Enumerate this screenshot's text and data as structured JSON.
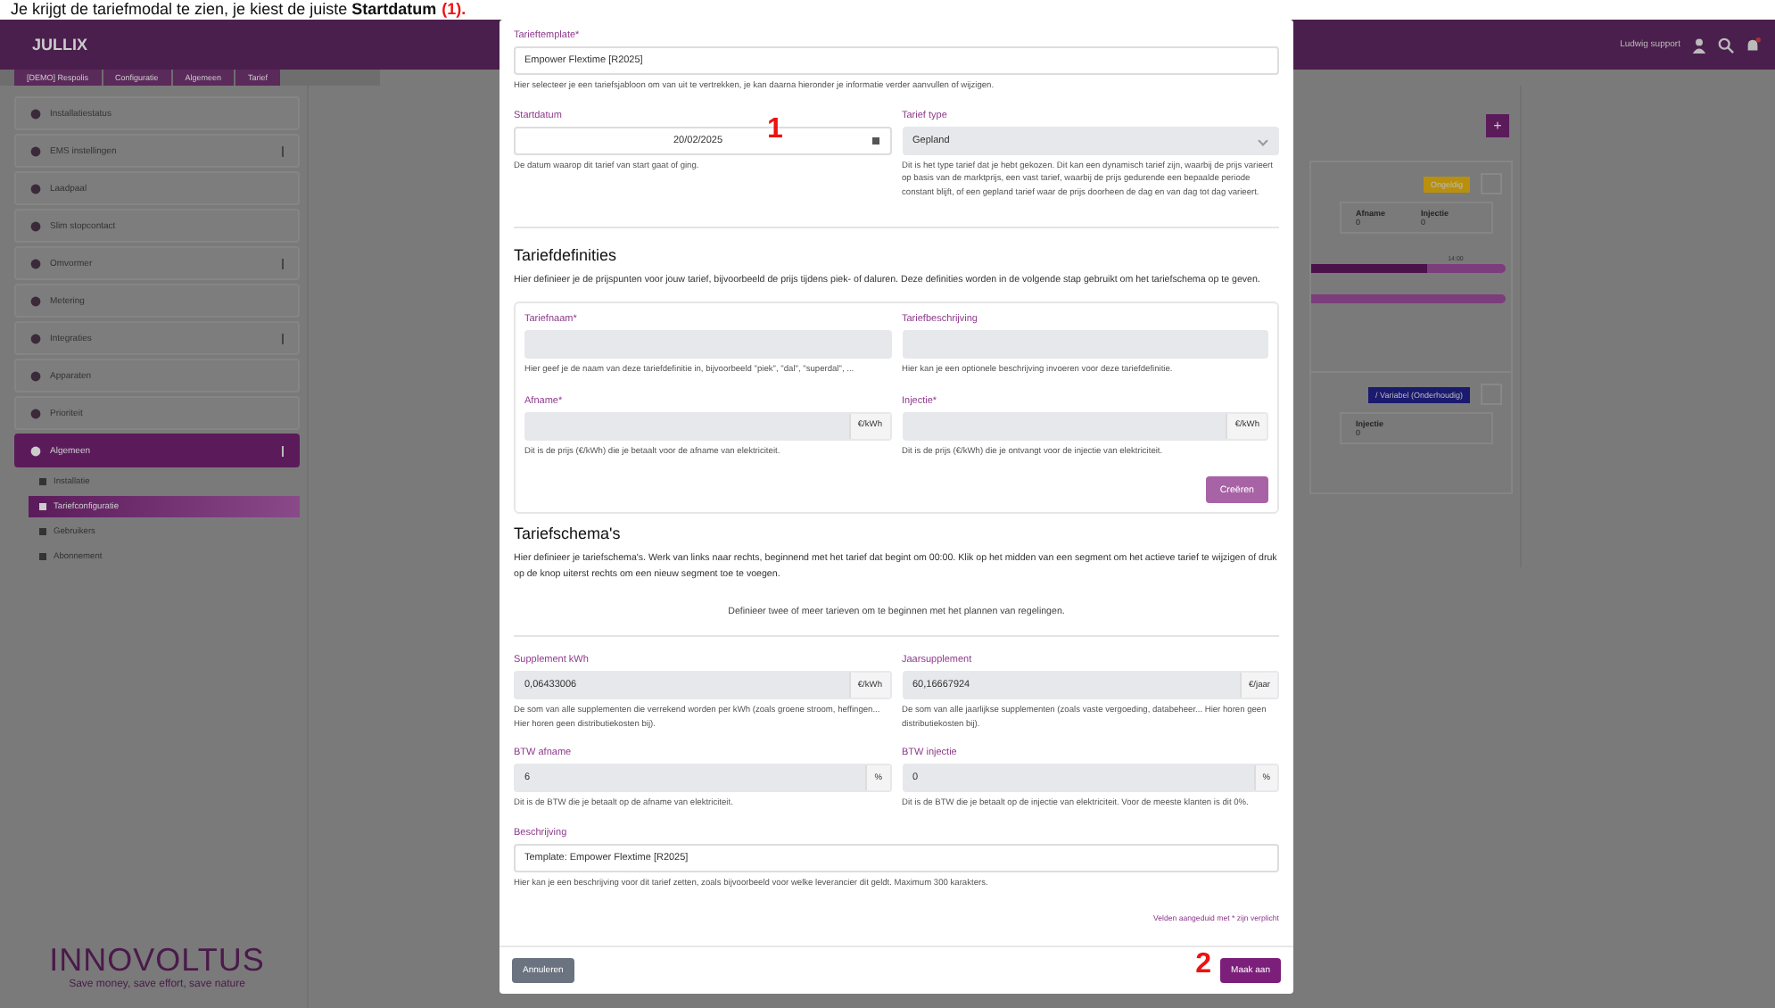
{
  "caption": {
    "text": "Je krijgt de tariefmodal te zien, je kiest de juiste **Startdatum**",
    "marker": "(1)."
  },
  "header": {
    "logo": "JULLIX",
    "user": "Ludwig support"
  },
  "breadcrumb": [
    {
      "label": "[DEMO] Respolis"
    },
    {
      "label": "Configuratie"
    },
    {
      "label": "Algemeen"
    },
    {
      "label": "Tarief"
    }
  ],
  "sidebar": {
    "items": [
      {
        "label": "Installatiestatus",
        "menu": false,
        "selected": false
      },
      {
        "label": "EMS instellingen",
        "menu": true,
        "selected": false
      },
      {
        "label": "Laadpaal",
        "menu": false,
        "selected": false
      },
      {
        "label": "Slim stopcontact",
        "menu": false,
        "selected": false
      },
      {
        "label": "Omvormer",
        "menu": true,
        "selected": false
      },
      {
        "label": "Metering",
        "menu": false,
        "selected": false
      },
      {
        "label": "Integraties",
        "menu": true,
        "selected": false
      },
      {
        "label": "Apparaten",
        "menu": false,
        "selected": false
      },
      {
        "label": "Prioriteit",
        "menu": false,
        "selected": false
      },
      {
        "label": "Algemeen",
        "menu": true,
        "selected": true,
        "children": [
          {
            "label": "Installatie",
            "selected": false
          },
          {
            "label": "Tariefconfiguratie",
            "selected": true
          },
          {
            "label": "Gebruikers",
            "selected": false
          },
          {
            "label": "Abonnement",
            "selected": false
          }
        ]
      }
    ],
    "brand": "INNOVOLTUS",
    "slogan": "Save money, save effort, save nature"
  },
  "background": {
    "add_button": "+",
    "cards": [
      {
        "badge": "Ongeldig",
        "color": "#b8900e",
        "stats": [
          {
            "label": "Afname",
            "value": "0"
          },
          {
            "label": "Injectie",
            "value": "0"
          }
        ],
        "bar_label": "14:00",
        "bars": [
          {
            "level": 0.6
          }
        ],
        "schedule_bar": true
      },
      {
        "badge": "/ Variabel (Onderhoudig)",
        "color": "#1a1a6e",
        "stats": [
          {
            "label": "Injectie",
            "value": "0"
          }
        ]
      }
    ]
  },
  "modal": {
    "general": [
      [
        {
          "label": "Tarieftemplate*",
          "value": "Empower Flextime [R2025]",
          "kind": "input",
          "hint": "Hier selecteer je een tariefsjabloon om van uit te vertrekken, je kan daarna hieronder je informatie verder aanvullen of wijzigen."
        }
      ],
      [
        {
          "label": "Startdatum",
          "value": "20/02/2025",
          "kind": "date",
          "hint": "De datum waarop dit tarief van start gaat of ging."
        },
        {
          "label": "Tarief type",
          "value": "Gepland",
          "kind": "select",
          "hint": "Dit is het type tarief dat je hebt gekozen. Dit kan een dynamisch tarief zijn, waarbij de prijs varieert op basis van de marktprijs, een vast tarief, waarbij de prijs gedurende een bepaalde periode constant blijft, of een gepland tarief waar de prijs doorheen de dag en van dag tot dag varieert."
        }
      ]
    ],
    "definitions": {
      "title": "Tariefdefinities",
      "intro": "Hier definieer je de prijspunten voor jouw tarief, bijvoorbeeld de prijs tijdens piek- of daluren. Deze definities worden in de volgende stap gebruikt om het tariefschema op te geven.",
      "rows": [
        [
          {
            "label": "Tariefnaam*",
            "kind": "readonly",
            "hint": "Hier geef je de naam van deze tariefdefinitie in, bijvoorbeeld \"piek\", \"dal\", \"superdal\", ..."
          },
          {
            "label": "Tariefbeschrijving",
            "kind": "readonly",
            "hint": "Hier kan je een optionele beschrijving invoeren voor deze tariefdefinitie."
          }
        ],
        [
          {
            "label": "Afname*",
            "unit": "€/kWh",
            "kind": "readonly",
            "hint": "Dit is de prijs (€/kWh) die je betaalt voor de afname van elektriciteit."
          },
          {
            "label": "Injectie*",
            "unit": "€/kWh",
            "kind": "readonly",
            "hint": "Dit is de prijs (€/kWh) die je ontvangt voor de injectie van elektriciteit."
          }
        ]
      ],
      "button": "Creëren"
    },
    "schedules": {
      "title": "Tariefschema's",
      "intro": "Hier definieer je tariefschema's. Werk van links naar rechts, beginnend met het tarief dat begint om 00:00. Klik op het midden van een segment om het actieve tarief te wijzigen of druk op de knop uiterst rechts om een nieuw segment toe te voegen.",
      "empty_note": "Definieer twee of meer tarieven om te beginnen met het plannen van regelingen."
    },
    "extra": [
      [
        {
          "label": "Supplement kWh",
          "value": "0,06433006",
          "unit": "€/kWh",
          "kind": "readonly",
          "hint": "De som van alle supplementen die verrekend worden per kWh (zoals groene stroom, heffingen... Hier horen geen distributiekosten bij)."
        },
        {
          "label": "Jaarsupplement",
          "value": "60,16667924",
          "unit": "€/jaar",
          "kind": "readonly",
          "hint": "De som van alle jaarlijkse supplementen (zoals vaste vergoeding, databeheer... Hier horen geen distributiekosten bij)."
        }
      ],
      [
        {
          "label": "BTW afname",
          "value": "6",
          "unit": "%",
          "kind": "readonly",
          "hint": "Dit is de BTW die je betaalt op de afname van elektriciteit."
        },
        {
          "label": "BTW injectie",
          "value": "0",
          "unit": "%",
          "kind": "readonly",
          "hint": "Dit is de BTW die je betaalt op de injectie van elektriciteit. Voor de meeste klanten is dit 0%."
        }
      ],
      [
        {
          "label": "Beschrijving",
          "value": "Template: Empower Flextime [R2025]",
          "kind": "input",
          "hint": "Hier kan je een beschrijving voor dit tarief zetten, zoals bijvoorbeeld voor welke leverancier dit geldt. Maximum 300 karakters."
        }
      ]
    ],
    "required_note": "Velden aangeduid met * zijn verplicht",
    "buttons": [
      {
        "label": "Annuleren",
        "kind": "secondary"
      },
      {
        "label": "Maak aan",
        "kind": "primary"
      }
    ],
    "annotations": [
      "1",
      "2"
    ]
  }
}
